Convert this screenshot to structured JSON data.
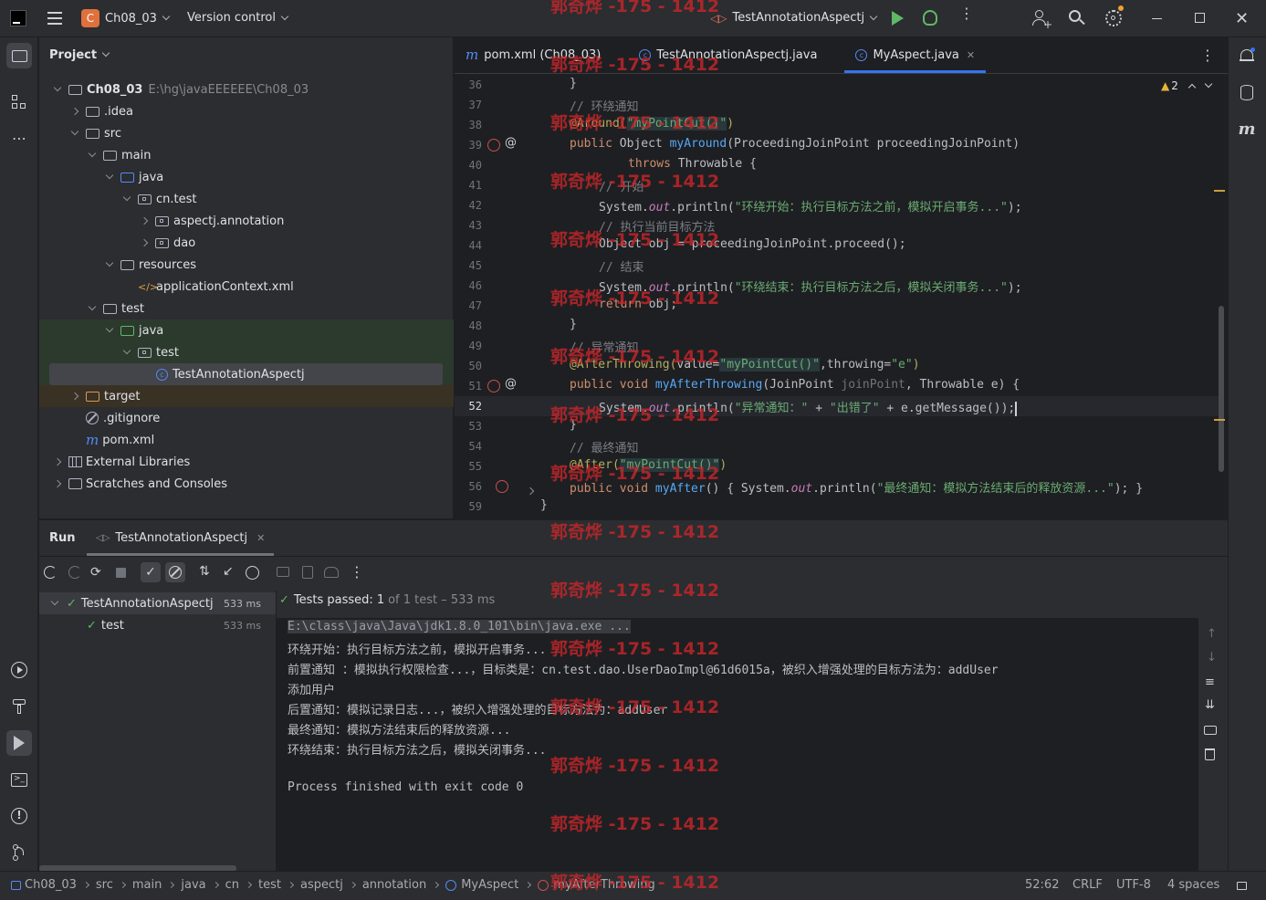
{
  "titlebar": {
    "project_badge": "C",
    "project_name": "Ch08_03",
    "vcs_label": "Version control",
    "run_config": "TestAnnotationAspectj"
  },
  "project_panel": {
    "title": "Project",
    "tree": [
      {
        "label": "Ch08_03",
        "extra": "E:\\hg\\javaEEEEEE\\Ch08_03"
      },
      {
        "label": ".idea"
      },
      {
        "label": "src"
      },
      {
        "label": "main"
      },
      {
        "label": "java"
      },
      {
        "label": "cn.test"
      },
      {
        "label": "aspectj.annotation"
      },
      {
        "label": "dao"
      },
      {
        "label": "resources"
      },
      {
        "label": "applicationContext.xml"
      },
      {
        "label": "test"
      },
      {
        "label": "java"
      },
      {
        "label": "test"
      },
      {
        "label": "TestAnnotationAspectj"
      },
      {
        "label": "target"
      },
      {
        "label": ".gitignore"
      },
      {
        "label": "pom.xml"
      },
      {
        "label": "External Libraries"
      },
      {
        "label": "Scratches and Consoles"
      }
    ]
  },
  "editor": {
    "tabs": [
      {
        "label": "pom.xml (Ch08_03)"
      },
      {
        "label": "TestAnnotationAspectj.java"
      },
      {
        "label": "MyAspect.java"
      }
    ],
    "warnings_count": "2",
    "line_numbers": [
      "36",
      "37",
      "38",
      "39",
      "40",
      "41",
      "42",
      "43",
      "44",
      "45",
      "46",
      "47",
      "48",
      "49",
      "50",
      "51",
      "52",
      "53",
      "54",
      "55",
      "56",
      "59"
    ],
    "code": {
      "l36": "}",
      "l37": "// 环绕通知",
      "l38_ann": "@Around(",
      "l38_str": "\"myPointCut()\"",
      "l38_end": ")",
      "l39_a": "public ",
      "l39_b": "Object ",
      "l39_fn": "myAround",
      "l39_c": "(ProceedingJoinPoint proceedingJoinPoint)",
      "l40_kw": "throws ",
      "l40_b": "Throwable {",
      "l41": "// 开始",
      "l42_a": "System.",
      "l42_out": "out",
      "l42_b": ".println(",
      "l42_str": "\"环绕开始：执行目标方法之前，模拟开启事务...\"",
      "l42_c": ");",
      "l43": "// 执行当前目标方法",
      "l44": "Object obj = proceedingJoinPoint.proceed();",
      "l45": "// 结束",
      "l46_a": "System.",
      "l46_out": "out",
      "l46_b": ".println(",
      "l46_str": "\"环绕结束：执行目标方法之后，模拟关闭事务...\"",
      "l46_c": ");",
      "l47_kw": "return ",
      "l47_b": "obj;",
      "l48": "}",
      "l49": "// 异常通知",
      "l50_ann": "@AfterThrowing(",
      "l50_b": "value=",
      "l50_str": "\"myPointCut()\"",
      "l50_c": ",throwing=",
      "l50_str2": "\"e\"",
      "l50_d": ")",
      "l51_a": "public void ",
      "l51_fn": "myAfterThrowing",
      "l51_b": "(JoinPoint ",
      "l51_p": "joinPoint",
      "l51_c": ", Throwable e) {",
      "l52_a": "System.",
      "l52_out": "out",
      "l52_b": ".println(",
      "l52_str": "\"异常通知：\"",
      "l52_c": " + ",
      "l52_str2": "\"出错了\"",
      "l52_d": " + e.getMessage());",
      "l53": "}",
      "l54": "// 最终通知",
      "l55_ann": "@After(",
      "l55_str": "\"myPointCut()\"",
      "l55_end": ")",
      "l56_a": "public void ",
      "l56_fn": "myAfter",
      "l56_b": "() { System.",
      "l56_out": "out",
      "l56_c": ".println(",
      "l56_str": "\"最终通知：模拟方法结束后的释放资源...\"",
      "l56_d": "); }",
      "l59": "}"
    }
  },
  "run_panel": {
    "title": "Run",
    "tab_label": "TestAnnotationAspectj",
    "tests_passed_label": "Tests passed:",
    "tests_passed_count": "1",
    "tests_passed_detail": "of 1 test – 533 ms",
    "tree": [
      {
        "label": "TestAnnotationAspectj",
        "time": "533 ms"
      },
      {
        "label": "test",
        "time": "533 ms"
      }
    ],
    "console": [
      "E:\\class\\java\\Java\\jdk1.8.0_101\\bin\\java.exe ...",
      "环绕开始：执行目标方法之前，模拟开启事务...",
      "前置通知 ：模拟执行权限检查...，目标类是：cn.test.dao.UserDaoImpl@61d6015a，被织入增强处理的目标方法为：addUser",
      "添加用户",
      "后置通知：模拟记录日志...，被织入增强处理的目标方法为：addUser",
      "最终通知：模拟方法结束后的释放资源...",
      "环绕结束：执行目标方法之后，模拟关闭事务...",
      "",
      "Process finished with exit code 0"
    ]
  },
  "statusbar": {
    "breadcrumbs": [
      "Ch08_03",
      "src",
      "main",
      "java",
      "cn",
      "test",
      "aspectj",
      "annotation",
      "MyAspect",
      "myAfterThrowing"
    ],
    "position": "52:62",
    "line_sep": "CRLF",
    "encoding": "UTF-8",
    "indent": "4 spaces"
  },
  "watermark": "郭奇烨 -175 - 1412",
  "colors": {
    "accent": "#3574f0",
    "success": "#5fb865",
    "watermark": "#c9262a"
  }
}
